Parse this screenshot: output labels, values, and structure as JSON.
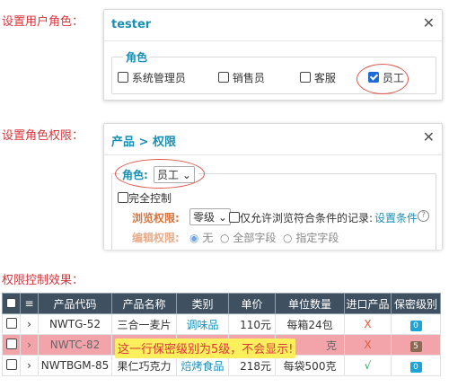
{
  "labels": {
    "set_user_role": "设置用户角色：",
    "set_role_permission": "设置角色权限：",
    "permission_effect": "权限控制效果："
  },
  "dialog1": {
    "title": "tester",
    "legend": "角色",
    "roles": [
      {
        "label": "系统管理员",
        "checked": false
      },
      {
        "label": "销售员",
        "checked": false
      },
      {
        "label": "客服",
        "checked": false
      },
      {
        "label": "员工",
        "checked": true
      }
    ]
  },
  "dialog2": {
    "title": "产品 > 权限",
    "legend_role": "角色:",
    "role_value": "员工",
    "full_control": "完全控制",
    "browse_label": "浏览权限:",
    "browse_value": "零级",
    "browse_checkbox": "仅允许浏览符合条件的记录:",
    "set_condition": "设置条件",
    "help": "?",
    "edit_label": "编辑权限:",
    "edit_options": [
      "无",
      "全部字段",
      "指定字段"
    ]
  },
  "table": {
    "headers": [
      "产品代码",
      "产品名称",
      "类别",
      "单价",
      "单位数量",
      "进口产品",
      "保密级别"
    ],
    "rows": [
      {
        "code": "NWTG-52",
        "name": "三合一麦片",
        "category": "调味品",
        "price": "110元",
        "unit": "每箱24包",
        "imported": "X",
        "level": "0",
        "level_color": "#1ea3d9"
      },
      {
        "code": "NWTC-82",
        "name": "",
        "category": "",
        "price": "",
        "unit": "克",
        "imported": "X",
        "level": "5",
        "level_color": "#8a6a56"
      },
      {
        "code": "NWTBGM-85",
        "name": "果仁巧克力",
        "category": "焙烤食品",
        "price": "218元",
        "unit": "每袋500克",
        "imported": "√",
        "level": "0",
        "level_color": "#1ea3d9"
      }
    ],
    "highlight": "这一行保密级别为5级，不会显示!"
  },
  "colors": {
    "accent": "#1a8fb5",
    "annotation": "#d9343c",
    "header_bg": "#3f5060",
    "hidden_row": "#f2a4aa"
  }
}
